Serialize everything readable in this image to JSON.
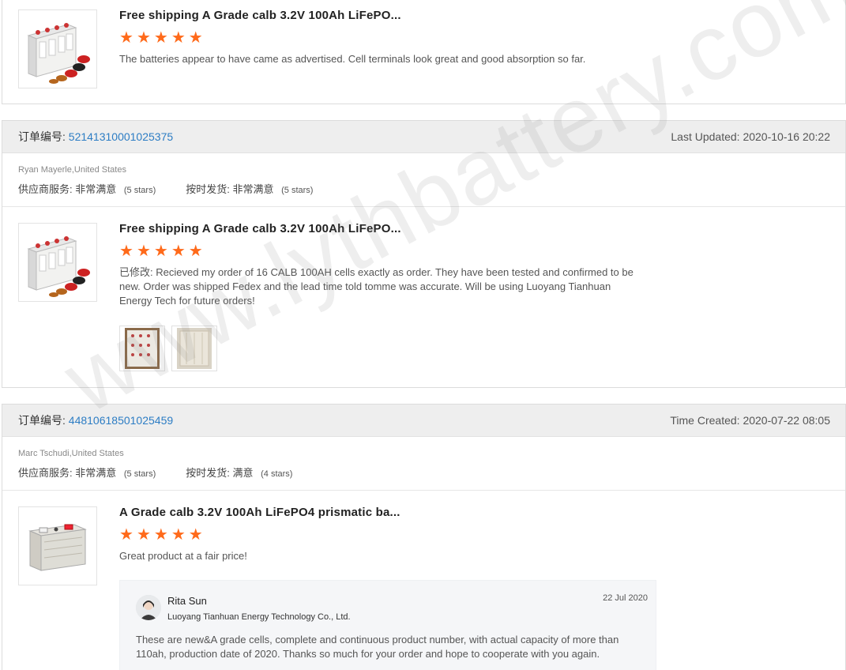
{
  "reviews": [
    {
      "product_title": "Free shipping A Grade calb 3.2V 100Ah LiFePO...",
      "stars": 5,
      "review_text": "The batteries appear to have came as advertised. Cell terminals look great and good absorption so far."
    },
    {
      "order_label": "订单编号:",
      "order_number": "52141310001025375",
      "date_label": "Last Updated:",
      "date_value": "2020-10-16 20:22",
      "buyer": "Ryan Mayerle,United States",
      "supplier_label": "供应商服务:",
      "supplier_rating": "非常满意",
      "supplier_stars": "(5 stars)",
      "shipping_label": "按时发货:",
      "shipping_rating": "非常满意",
      "shipping_stars": "(5 stars)",
      "product_title": "Free shipping A Grade calb 3.2V 100Ah LiFePO...",
      "stars": 5,
      "edited_tag": "已修改:",
      "review_text": " Recieved my order of 16 CALB 100AH cells exactly as order. They have been tested and confirmed to be new. Order was shipped Fedex and the lead time told tomme was accurate. Will be using Luoyang Tianhuan Energy Tech for future orders!",
      "photos": [
        "review-photo-1",
        "review-photo-2"
      ]
    },
    {
      "order_label": "订单编号:",
      "order_number": "44810618501025459",
      "date_label": "Time Created:",
      "date_value": "2020-07-22 08:05",
      "buyer": "Marc Tschudi,United States",
      "supplier_label": "供应商服务:",
      "supplier_rating": "非常满意",
      "supplier_stars": "(5 stars)",
      "shipping_label": "按时发货:",
      "shipping_rating": "满意",
      "shipping_stars": "(4 stars)",
      "product_title": "A Grade calb 3.2V 100Ah LiFePO4 prismatic ba...",
      "stars": 5,
      "review_text": "Great product at a fair price!",
      "reply": {
        "name": "Rita Sun",
        "company": "Luoyang Tianhuan Energy Technology Co., Ltd.",
        "date": "22 Jul 2020",
        "text": "These are new&A grade cells, complete and continuous product number, with actual capacity of more than 110ah, production date of 2020. Thanks so much for your order and hope to cooperate with you again."
      }
    }
  ],
  "watermark": "www.lythbattery.com",
  "colors": {
    "star": "#ff6a1a",
    "order_link": "#2d7dc4",
    "header_bg": "#eeeeee"
  },
  "icons": {
    "star": "star-icon"
  }
}
